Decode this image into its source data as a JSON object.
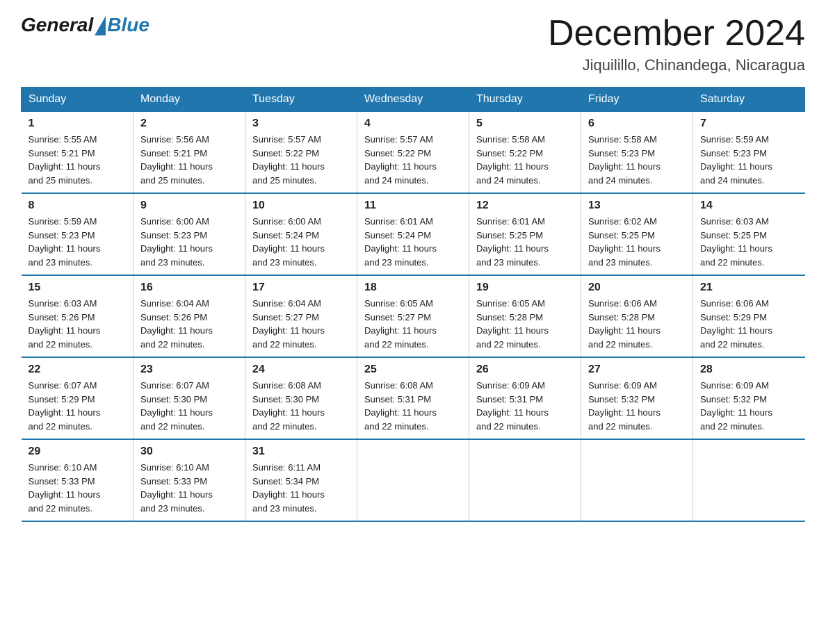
{
  "logo": {
    "general": "General",
    "triangle": "",
    "blue": "Blue"
  },
  "header": {
    "month_year": "December 2024",
    "location": "Jiquilillo, Chinandega, Nicaragua"
  },
  "days_of_week": [
    "Sunday",
    "Monday",
    "Tuesday",
    "Wednesday",
    "Thursday",
    "Friday",
    "Saturday"
  ],
  "weeks": [
    [
      {
        "day": "1",
        "info": "Sunrise: 5:55 AM\nSunset: 5:21 PM\nDaylight: 11 hours\nand 25 minutes."
      },
      {
        "day": "2",
        "info": "Sunrise: 5:56 AM\nSunset: 5:21 PM\nDaylight: 11 hours\nand 25 minutes."
      },
      {
        "day": "3",
        "info": "Sunrise: 5:57 AM\nSunset: 5:22 PM\nDaylight: 11 hours\nand 25 minutes."
      },
      {
        "day": "4",
        "info": "Sunrise: 5:57 AM\nSunset: 5:22 PM\nDaylight: 11 hours\nand 24 minutes."
      },
      {
        "day": "5",
        "info": "Sunrise: 5:58 AM\nSunset: 5:22 PM\nDaylight: 11 hours\nand 24 minutes."
      },
      {
        "day": "6",
        "info": "Sunrise: 5:58 AM\nSunset: 5:23 PM\nDaylight: 11 hours\nand 24 minutes."
      },
      {
        "day": "7",
        "info": "Sunrise: 5:59 AM\nSunset: 5:23 PM\nDaylight: 11 hours\nand 24 minutes."
      }
    ],
    [
      {
        "day": "8",
        "info": "Sunrise: 5:59 AM\nSunset: 5:23 PM\nDaylight: 11 hours\nand 23 minutes."
      },
      {
        "day": "9",
        "info": "Sunrise: 6:00 AM\nSunset: 5:23 PM\nDaylight: 11 hours\nand 23 minutes."
      },
      {
        "day": "10",
        "info": "Sunrise: 6:00 AM\nSunset: 5:24 PM\nDaylight: 11 hours\nand 23 minutes."
      },
      {
        "day": "11",
        "info": "Sunrise: 6:01 AM\nSunset: 5:24 PM\nDaylight: 11 hours\nand 23 minutes."
      },
      {
        "day": "12",
        "info": "Sunrise: 6:01 AM\nSunset: 5:25 PM\nDaylight: 11 hours\nand 23 minutes."
      },
      {
        "day": "13",
        "info": "Sunrise: 6:02 AM\nSunset: 5:25 PM\nDaylight: 11 hours\nand 23 minutes."
      },
      {
        "day": "14",
        "info": "Sunrise: 6:03 AM\nSunset: 5:25 PM\nDaylight: 11 hours\nand 22 minutes."
      }
    ],
    [
      {
        "day": "15",
        "info": "Sunrise: 6:03 AM\nSunset: 5:26 PM\nDaylight: 11 hours\nand 22 minutes."
      },
      {
        "day": "16",
        "info": "Sunrise: 6:04 AM\nSunset: 5:26 PM\nDaylight: 11 hours\nand 22 minutes."
      },
      {
        "day": "17",
        "info": "Sunrise: 6:04 AM\nSunset: 5:27 PM\nDaylight: 11 hours\nand 22 minutes."
      },
      {
        "day": "18",
        "info": "Sunrise: 6:05 AM\nSunset: 5:27 PM\nDaylight: 11 hours\nand 22 minutes."
      },
      {
        "day": "19",
        "info": "Sunrise: 6:05 AM\nSunset: 5:28 PM\nDaylight: 11 hours\nand 22 minutes."
      },
      {
        "day": "20",
        "info": "Sunrise: 6:06 AM\nSunset: 5:28 PM\nDaylight: 11 hours\nand 22 minutes."
      },
      {
        "day": "21",
        "info": "Sunrise: 6:06 AM\nSunset: 5:29 PM\nDaylight: 11 hours\nand 22 minutes."
      }
    ],
    [
      {
        "day": "22",
        "info": "Sunrise: 6:07 AM\nSunset: 5:29 PM\nDaylight: 11 hours\nand 22 minutes."
      },
      {
        "day": "23",
        "info": "Sunrise: 6:07 AM\nSunset: 5:30 PM\nDaylight: 11 hours\nand 22 minutes."
      },
      {
        "day": "24",
        "info": "Sunrise: 6:08 AM\nSunset: 5:30 PM\nDaylight: 11 hours\nand 22 minutes."
      },
      {
        "day": "25",
        "info": "Sunrise: 6:08 AM\nSunset: 5:31 PM\nDaylight: 11 hours\nand 22 minutes."
      },
      {
        "day": "26",
        "info": "Sunrise: 6:09 AM\nSunset: 5:31 PM\nDaylight: 11 hours\nand 22 minutes."
      },
      {
        "day": "27",
        "info": "Sunrise: 6:09 AM\nSunset: 5:32 PM\nDaylight: 11 hours\nand 22 minutes."
      },
      {
        "day": "28",
        "info": "Sunrise: 6:09 AM\nSunset: 5:32 PM\nDaylight: 11 hours\nand 22 minutes."
      }
    ],
    [
      {
        "day": "29",
        "info": "Sunrise: 6:10 AM\nSunset: 5:33 PM\nDaylight: 11 hours\nand 22 minutes."
      },
      {
        "day": "30",
        "info": "Sunrise: 6:10 AM\nSunset: 5:33 PM\nDaylight: 11 hours\nand 23 minutes."
      },
      {
        "day": "31",
        "info": "Sunrise: 6:11 AM\nSunset: 5:34 PM\nDaylight: 11 hours\nand 23 minutes."
      },
      {
        "day": "",
        "info": ""
      },
      {
        "day": "",
        "info": ""
      },
      {
        "day": "",
        "info": ""
      },
      {
        "day": "",
        "info": ""
      }
    ]
  ]
}
